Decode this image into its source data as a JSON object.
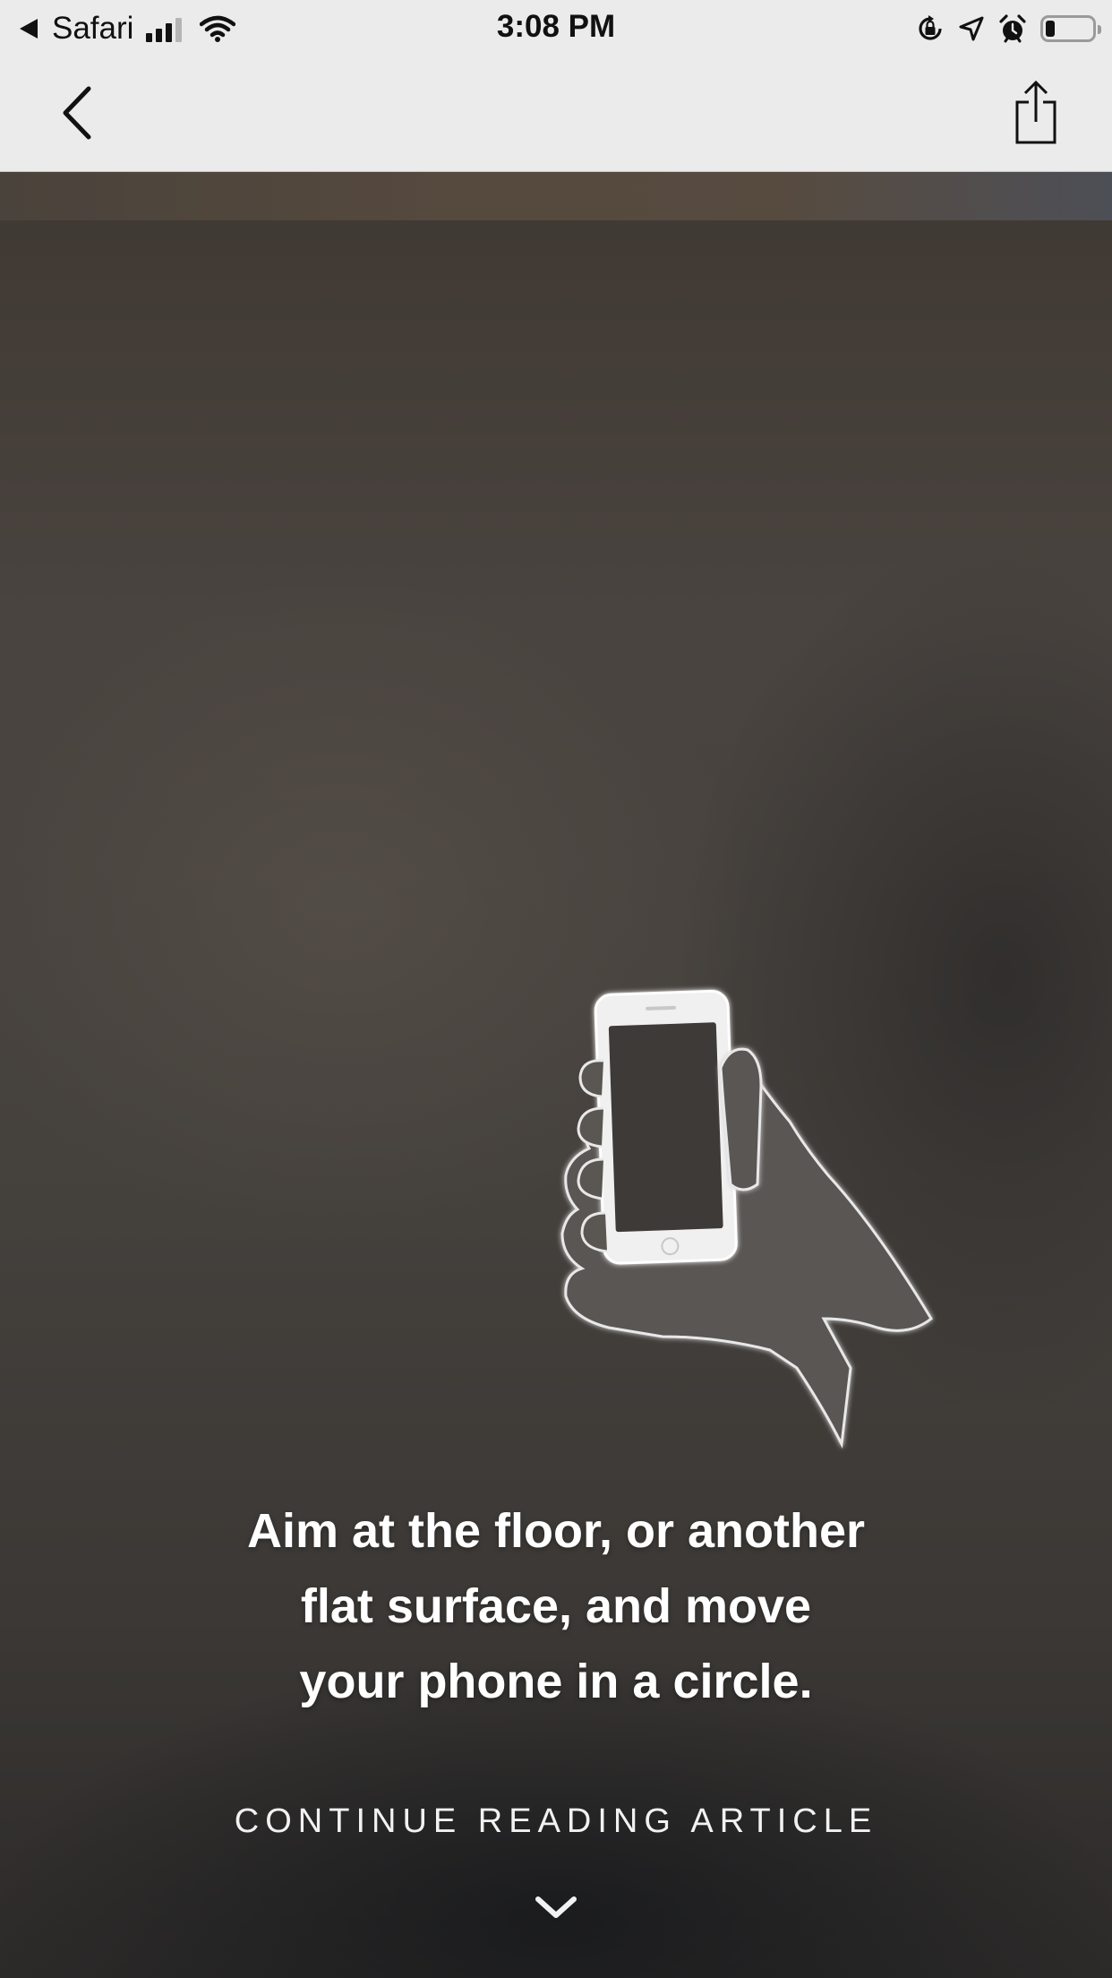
{
  "status_bar": {
    "carrier": "Safari",
    "time": "3:08 PM",
    "battery_level": 0.15
  },
  "nav": {
    "back_icon": "chevron-left-icon",
    "share_icon": "share-icon"
  },
  "content": {
    "illustration_icon": "hand-holding-phone-icon",
    "instruction_lines": [
      "Aim at the floor, or another",
      "flat surface, and move",
      "your phone in a circle."
    ],
    "continue_label": "CONTINUE READING ARTICLE",
    "chevron_icon": "chevron-down-icon"
  },
  "colors": {
    "bar_background": "#ebebeb",
    "content_background": "#45413d",
    "text": "#ffffff"
  }
}
